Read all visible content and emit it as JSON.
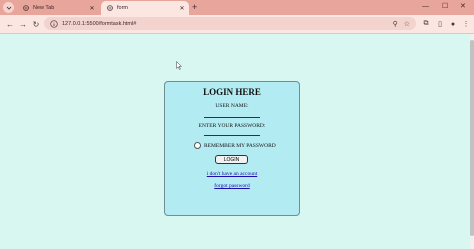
{
  "browser": {
    "tabs": [
      {
        "title": "New Tab",
        "active": false
      },
      {
        "title": "form",
        "active": true
      }
    ],
    "url": "127.0.0.1:5500/formtask.html#",
    "colors": {
      "tabstrip": "#e8a59b",
      "toolbar": "#fbe6e2",
      "page_bg": "#d9f7f1",
      "box_bg": "#b2ebf2"
    }
  },
  "login": {
    "title": "LOGIN HERE",
    "username_label": "USER NAME:",
    "username_value": "",
    "password_label": "ENTER YOUR PASSWORD:",
    "password_value": "",
    "remember_label": "REMEMBER MY PASSWORD",
    "remember_checked": false,
    "button_label": "LOGIN",
    "no_account_link": "i don't have an account",
    "forgot_link": "forgot password"
  }
}
